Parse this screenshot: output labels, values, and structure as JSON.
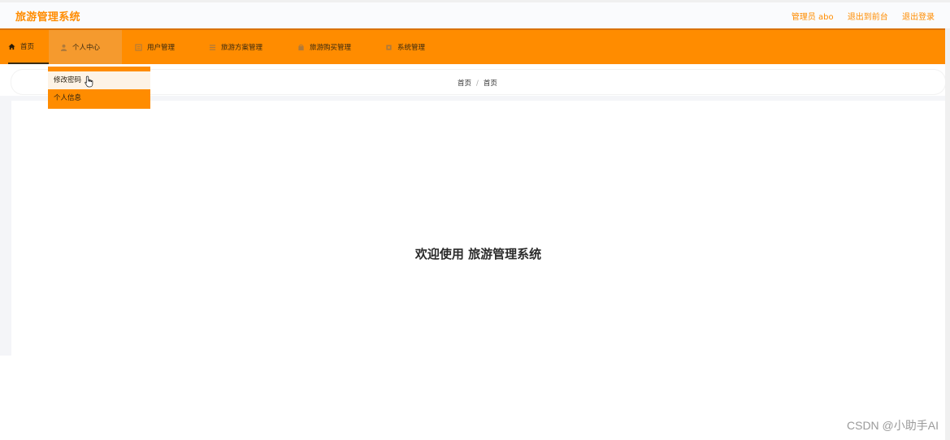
{
  "app": {
    "title": "旅游管理系统"
  },
  "header": {
    "user_label": "管理员 abo",
    "to_frontend": "退出到前台",
    "logout": "退出登录"
  },
  "nav": {
    "items": [
      {
        "label": "首页",
        "icon": "home-icon"
      },
      {
        "label": "个人中心",
        "icon": "user-icon"
      },
      {
        "label": "用户管理",
        "icon": "users-icon"
      },
      {
        "label": "旅游方案管理",
        "icon": "list-icon"
      },
      {
        "label": "旅游购买管理",
        "icon": "cart-icon"
      },
      {
        "label": "系统管理",
        "icon": "settings-icon"
      }
    ],
    "active": "首页",
    "open_menu": "个人中心"
  },
  "dropdown": {
    "items": [
      {
        "label": "修改密码"
      },
      {
        "label": "个人信息"
      }
    ]
  },
  "breadcrumb": {
    "items": [
      "首页",
      "首页"
    ],
    "separator": "/"
  },
  "main": {
    "welcome": "欢迎使用 旅游管理系统"
  },
  "watermark": "CSDN @小助手AI",
  "colors": {
    "accent": "#ff8c00",
    "nav_text": "#3a2a10",
    "content_bg": "#f4f5f8"
  }
}
